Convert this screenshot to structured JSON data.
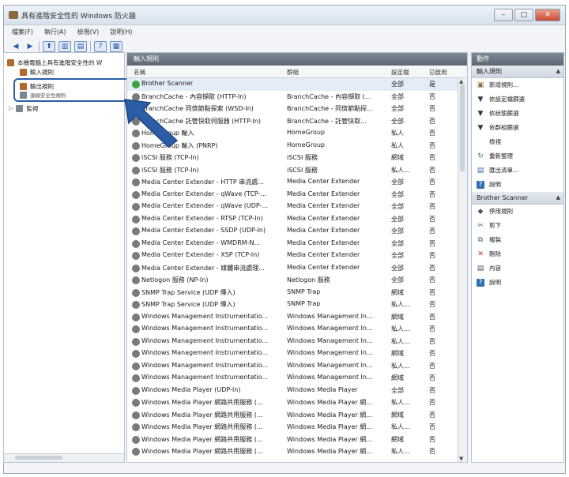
{
  "window": {
    "title": "具有進階安全性的 Windows 防火牆",
    "buttons": [
      "–",
      "□",
      "✕"
    ]
  },
  "menu": [
    "檔案(F)",
    "執行(A)",
    "檢視(V)",
    "說明(H)"
  ],
  "tree": {
    "root": "本機電腦上具有進階安全性的 W",
    "items": [
      "輸入規則",
      "輸出規則",
      "連線安全性規則",
      "監視"
    ]
  },
  "center": {
    "header": "輸入規則",
    "columns": [
      "名稱",
      "群組",
      "設定檔",
      "已啟用"
    ],
    "rows": [
      {
        "name": "Brother Scanner",
        "group": "",
        "profile": "全部",
        "enabled": "是",
        "highlight": true,
        "active": true
      },
      {
        "name": "BranchCache - 內容擷取 (HTTP-In)",
        "group": "BranchCache - 內容擷取 (...",
        "profile": "全部",
        "enabled": "否"
      },
      {
        "name": "BranchCache 同儕節點探索 (WSD-In)",
        "group": "BranchCache - 同儕節點探...",
        "profile": "全部",
        "enabled": "否"
      },
      {
        "name": "BranchCache 託管快取伺服器 (HTTP-In)",
        "group": "BranchCache - 託管快取...",
        "profile": "全部",
        "enabled": "否"
      },
      {
        "name": "HomeGroup 輸入",
        "group": "HomeGroup",
        "profile": "私人",
        "enabled": "否"
      },
      {
        "name": "HomeGroup 輸入 (PNRP)",
        "group": "HomeGroup",
        "profile": "私人",
        "enabled": "否"
      },
      {
        "name": "iSCSI 服務 (TCP-In)",
        "group": "iSCSI 服務",
        "profile": "網域",
        "enabled": "否"
      },
      {
        "name": "iSCSI 服務 (TCP-In)",
        "group": "iSCSI 服務",
        "profile": "私人...",
        "enabled": "否"
      },
      {
        "name": "Media Center Extender - HTTP 串流處...",
        "group": "Media Center Extender",
        "profile": "全部",
        "enabled": "否"
      },
      {
        "name": "Media Center Extender - qWave (TCP-...",
        "group": "Media Center Extender",
        "profile": "全部",
        "enabled": "否"
      },
      {
        "name": "Media Center Extender - qWave (UDP-...",
        "group": "Media Center Extender",
        "profile": "全部",
        "enabled": "否"
      },
      {
        "name": "Media Center Extender - RTSP (TCP-In)",
        "group": "Media Center Extender",
        "profile": "全部",
        "enabled": "否"
      },
      {
        "name": "Media Center Extender - SSDP (UDP-In)",
        "group": "Media Center Extender",
        "profile": "全部",
        "enabled": "否"
      },
      {
        "name": "Media Center Extender - WMDRM-N...",
        "group": "Media Center Extender",
        "profile": "全部",
        "enabled": "否"
      },
      {
        "name": "Media Center Extender - XSP (TCP-In)",
        "group": "Media Center Extender",
        "profile": "全部",
        "enabled": "否"
      },
      {
        "name": "Media Center Extender - 媒體串流處理...",
        "group": "Media Center Extender",
        "profile": "全部",
        "enabled": "否"
      },
      {
        "name": "Netlogon 服務 (NP-In)",
        "group": "Netlogon 服務",
        "profile": "全部",
        "enabled": "否"
      },
      {
        "name": "SNMP Trap Service (UDP 傳入)",
        "group": "SNMP Trap",
        "profile": "網域",
        "enabled": "否"
      },
      {
        "name": "SNMP Trap Service (UDP 傳入)",
        "group": "SNMP Trap",
        "profile": "私人...",
        "enabled": "否"
      },
      {
        "name": "Windows Management Instrumentatio...",
        "group": "Windows Management In...",
        "profile": "網域",
        "enabled": "否"
      },
      {
        "name": "Windows Management Instrumentatio...",
        "group": "Windows Management In...",
        "profile": "私人...",
        "enabled": "否"
      },
      {
        "name": "Windows Management Instrumentatio...",
        "group": "Windows Management In...",
        "profile": "私人...",
        "enabled": "否"
      },
      {
        "name": "Windows Management Instrumentatio...",
        "group": "Windows Management In...",
        "profile": "網域",
        "enabled": "否"
      },
      {
        "name": "Windows Management Instrumentatio...",
        "group": "Windows Management In...",
        "profile": "私人...",
        "enabled": "否"
      },
      {
        "name": "Windows Management Instrumentatio...",
        "group": "Windows Management In...",
        "profile": "網域",
        "enabled": "否"
      },
      {
        "name": "Windows Media Player (UDP-In)",
        "group": "Windows Media Player",
        "profile": "全部",
        "enabled": "否"
      },
      {
        "name": "Windows Media Player 網路共用服務 (...",
        "group": "Windows Media Player 網...",
        "profile": "私人...",
        "enabled": "否"
      },
      {
        "name": "Windows Media Player 網路共用服務 (...",
        "group": "Windows Media Player 網...",
        "profile": "網域",
        "enabled": "否"
      },
      {
        "name": "Windows Media Player 網路共用服務 (...",
        "group": "Windows Media Player 網...",
        "profile": "私人...",
        "enabled": "否"
      },
      {
        "name": "Windows Media Player 網路共用服務 (...",
        "group": "Windows Media Player 網...",
        "profile": "網域",
        "enabled": "否"
      },
      {
        "name": "Windows Media Player 網路共用服務 (...",
        "group": "Windows Media Player 網...",
        "profile": "私人...",
        "enabled": "否"
      }
    ]
  },
  "actions": {
    "title": "動作",
    "group1": {
      "label": "輸入規則",
      "items": [
        {
          "label": "新增規則...",
          "icon": "new-rule-icon",
          "glyph": "▣",
          "color": "#8a6a3a"
        },
        {
          "label": "依設定檔篩選",
          "icon": "filter-icon",
          "glyph": "▼",
          "color": "#2a3a5a"
        },
        {
          "label": "依狀態篩選",
          "icon": "filter-icon",
          "glyph": "▼",
          "color": "#2a3a5a"
        },
        {
          "label": "依群組篩選",
          "icon": "filter-icon",
          "glyph": "▼",
          "color": "#2a3a5a"
        },
        {
          "label": "檢視",
          "icon": "",
          "glyph": "",
          "color": "#333"
        },
        {
          "label": "重新整理",
          "icon": "refresh-icon",
          "glyph": "↻",
          "color": "#2f8a2f"
        },
        {
          "label": "匯出清單...",
          "icon": "export-icon",
          "glyph": "▤",
          "color": "#2f6fb0"
        },
        {
          "label": "說明",
          "icon": "help-icon",
          "glyph": "?",
          "color": "#ffffff"
        }
      ]
    },
    "group2": {
      "label": "Brother Scanner",
      "items": [
        {
          "label": "停用規則",
          "icon": "disable-icon",
          "glyph": "◆",
          "color": "#555"
        },
        {
          "label": "剪下",
          "icon": "cut-icon",
          "glyph": "✂",
          "color": "#2f5fa8"
        },
        {
          "label": "複製",
          "icon": "copy-icon",
          "glyph": "⧉",
          "color": "#2f5fa8"
        },
        {
          "label": "刪除",
          "icon": "delete-icon",
          "glyph": "✕",
          "color": "#d12a1a"
        },
        {
          "label": "內容",
          "icon": "properties-icon",
          "glyph": "▤",
          "color": "#555"
        },
        {
          "label": "說明",
          "icon": "help-icon",
          "glyph": "?",
          "color": "#ffffff"
        }
      ]
    }
  }
}
